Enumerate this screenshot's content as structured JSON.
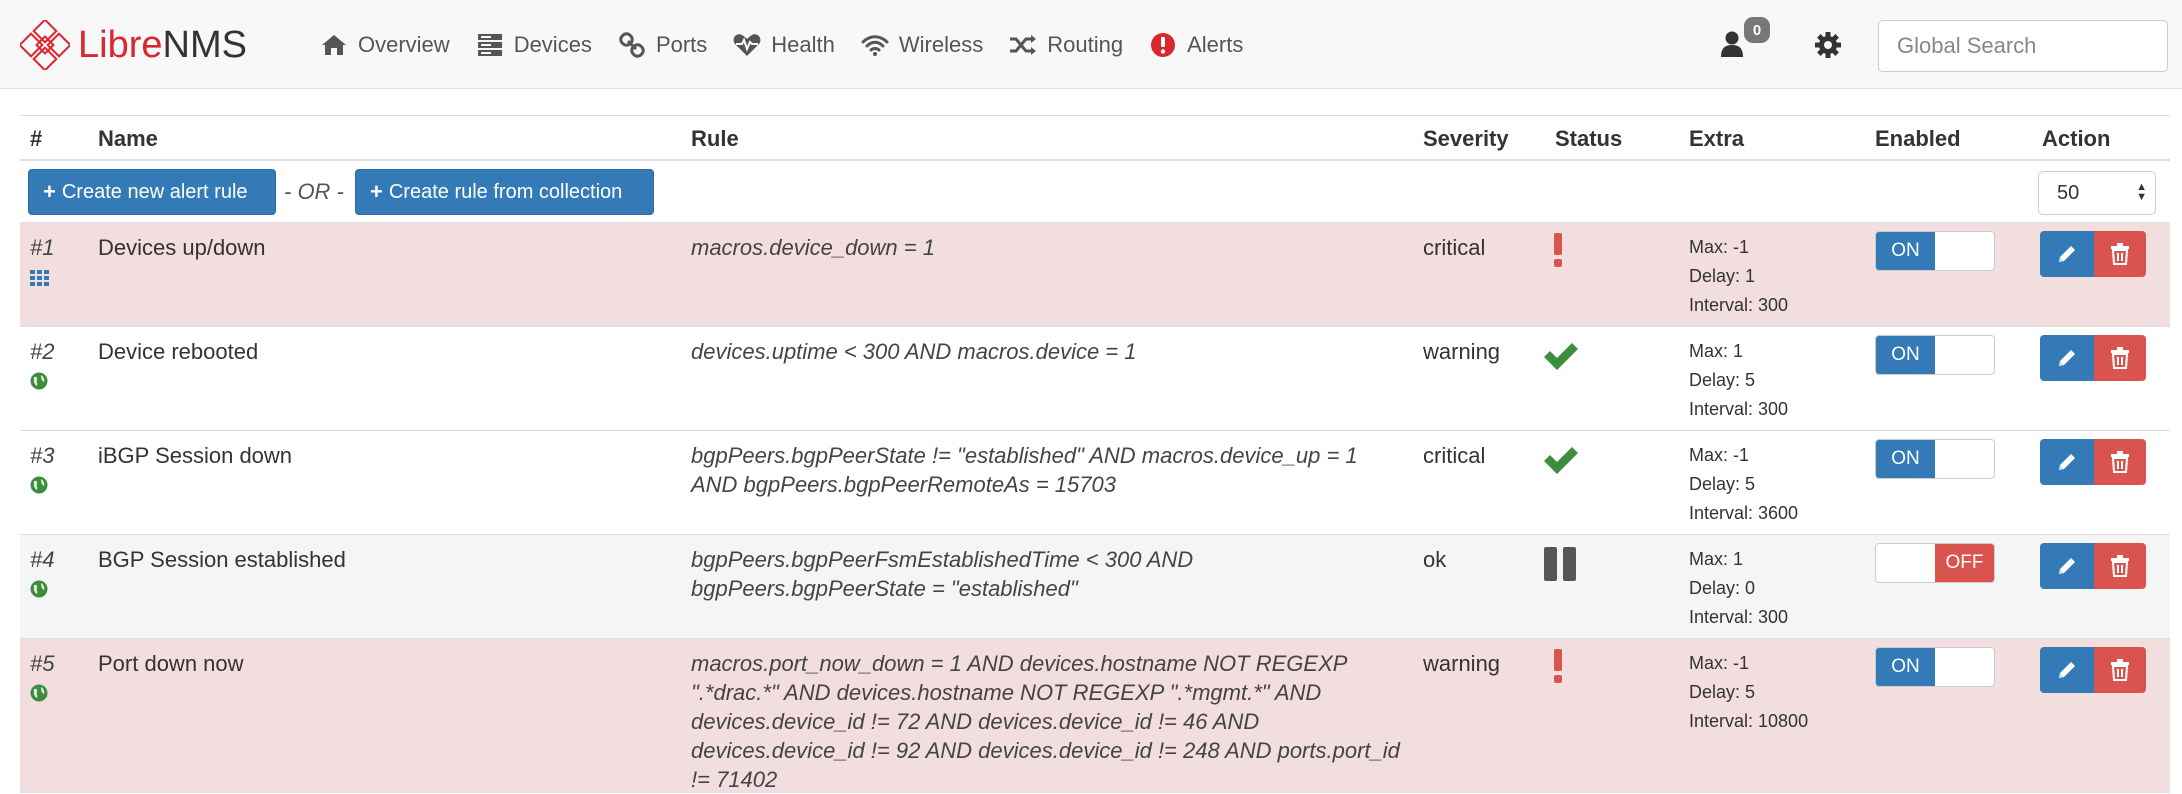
{
  "brand": {
    "part1": "Libre",
    "part2": "NMS"
  },
  "nav": [
    {
      "label": "Overview",
      "icon": "home-icon"
    },
    {
      "label": "Devices",
      "icon": "server-icon"
    },
    {
      "label": "Ports",
      "icon": "link-icon"
    },
    {
      "label": "Health",
      "icon": "heartbeat-icon"
    },
    {
      "label": "Wireless",
      "icon": "wifi-icon"
    },
    {
      "label": "Routing",
      "icon": "random-icon"
    },
    {
      "label": "Alerts",
      "icon": "alert-circle-icon"
    }
  ],
  "header_right": {
    "notification_count": "0",
    "search_placeholder": "Global Search"
  },
  "table": {
    "columns": [
      "#",
      "Name",
      "Rule",
      "Severity",
      "Status",
      "Extra",
      "Enabled",
      "Action"
    ],
    "toolbar": {
      "create_new": "Create new alert rule",
      "or_text": "- OR -",
      "create_from_collection": "Create rule from collection",
      "page_size": "50"
    },
    "rows": [
      {
        "num": "#1",
        "scope_icon": "grid-icon",
        "name": "Devices up/down",
        "rule": "macros.device_down = 1",
        "severity": "critical",
        "status": "alerting",
        "extra": [
          "Max: -1",
          "Delay: 1",
          "Interval: 300"
        ],
        "enabled": "ON"
      },
      {
        "num": "#2",
        "scope_icon": "globe-icon",
        "name": "Device rebooted",
        "rule": "devices.uptime < 300 AND macros.device = 1",
        "severity": "warning",
        "status": "ok",
        "extra": [
          "Max: 1",
          "Delay: 5",
          "Interval: 300"
        ],
        "enabled": "ON"
      },
      {
        "num": "#3",
        "scope_icon": "globe-icon",
        "name": "iBGP Session down",
        "rule": "bgpPeers.bgpPeerState != \"established\" AND macros.device_up = 1 AND bgpPeers.bgpPeerRemoteAs = 15703",
        "severity": "critical",
        "status": "ok",
        "extra": [
          "Max: -1",
          "Delay: 5",
          "Interval: 3600"
        ],
        "enabled": "ON"
      },
      {
        "num": "#4",
        "scope_icon": "globe-icon",
        "name": "BGP Session established",
        "rule": "bgpPeers.bgpPeerFsmEstablishedTime < 300 AND bgpPeers.bgpPeerState = \"established\"",
        "severity": "ok",
        "status": "paused",
        "extra": [
          "Max: 1",
          "Delay: 0",
          "Interval: 300"
        ],
        "enabled": "OFF"
      },
      {
        "num": "#5",
        "scope_icon": "globe-icon",
        "name": "Port down now",
        "rule": "macros.port_now_down = 1 AND devices.hostname NOT REGEXP \".*drac.*\" AND devices.hostname NOT REGEXP \".*mgmt.*\" AND devices.device_id != 72 AND devices.device_id != 46 AND devices.device_id != 92 AND devices.device_id != 248 AND ports.port_id != 71402",
        "severity": "warning",
        "status": "alerting",
        "extra": [
          "Max: -1",
          "Delay: 5",
          "Interval: 10800"
        ],
        "enabled": "ON"
      }
    ]
  },
  "colors": {
    "brand_red": "#d9272e",
    "primary": "#337ab7",
    "danger": "#d9534f",
    "success": "#3c8d3c",
    "row_danger_bg": "#f2dede"
  }
}
